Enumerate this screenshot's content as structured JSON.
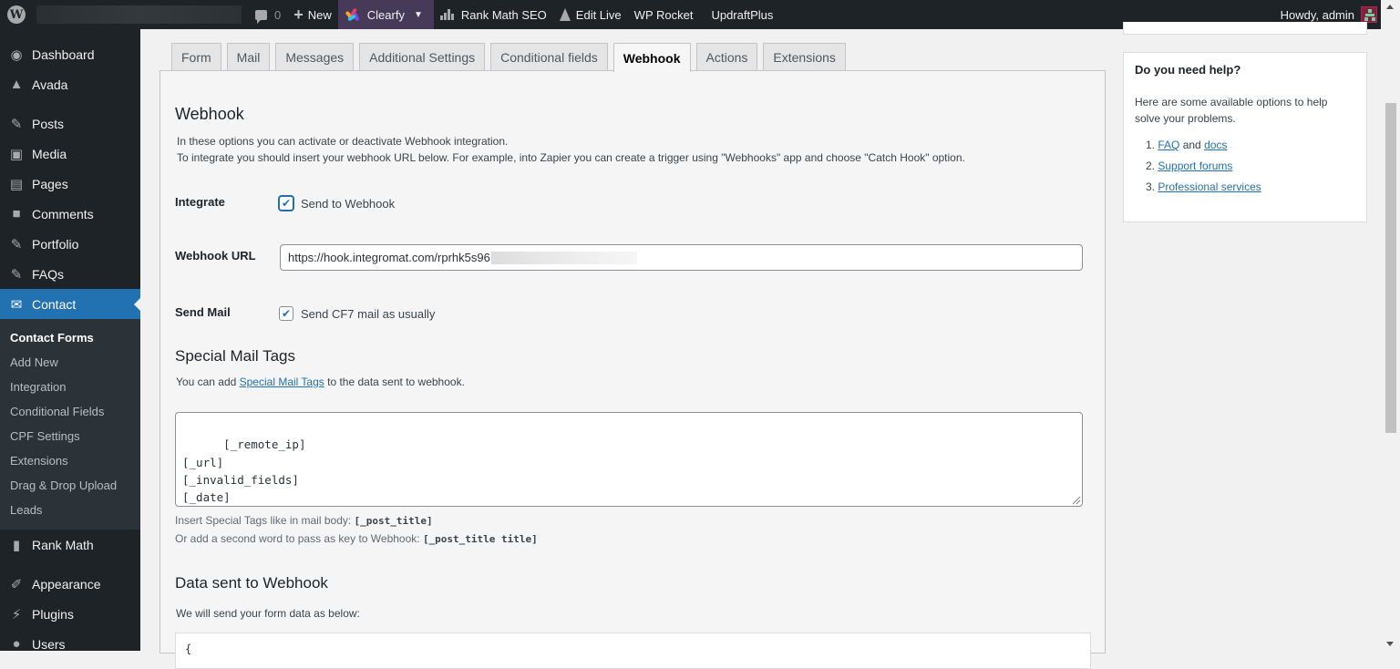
{
  "adminbar": {
    "comments_count": "0",
    "new_label": "New",
    "clearfy_label": "Clearfy",
    "rank_math_label": "Rank Math SEO",
    "edit_live_label": "Edit Live",
    "wp_rocket_label": "WP Rocket",
    "updraft_label": "UpdraftPlus",
    "howdy_label": "Howdy, admin",
    "clearfy_bg": "#473a58"
  },
  "sidebar": {
    "items": [
      {
        "label": "Dashboard",
        "icon": "dashboard-icon"
      },
      {
        "label": "Avada",
        "icon": "avada-icon"
      },
      {
        "label": "Posts",
        "icon": "pin-icon"
      },
      {
        "label": "Media",
        "icon": "media-icon"
      },
      {
        "label": "Pages",
        "icon": "pages-icon"
      },
      {
        "label": "Comments",
        "icon": "comment-icon"
      },
      {
        "label": "Portfolio",
        "icon": "pin-icon"
      },
      {
        "label": "FAQs",
        "icon": "pin-icon"
      },
      {
        "label": "Contact",
        "icon": "mail-icon"
      },
      {
        "label": "Rank Math",
        "icon": "rank-math-icon"
      },
      {
        "label": "Appearance",
        "icon": "brush-icon"
      },
      {
        "label": "Plugins",
        "icon": "plugin-icon"
      },
      {
        "label": "Users",
        "icon": "user-icon"
      }
    ],
    "submenu": [
      "Contact Forms",
      "Add New",
      "Integration",
      "Conditional Fields",
      "CPF Settings",
      "Extensions",
      "Drag & Drop Upload",
      "Leads"
    ],
    "accent": "#2271b1"
  },
  "tabs": [
    "Form",
    "Mail",
    "Messages",
    "Additional Settings",
    "Conditional fields",
    "Webhook",
    "Actions",
    "Extensions"
  ],
  "active_tab": "Webhook",
  "webhook": {
    "title": "Webhook",
    "desc_line1": "In these options you can activate or deactivate Webhook integration.",
    "desc_line2": "To integrate you should insert your webhook URL below. For example, into Zapier you can create a trigger using \"Webhooks\" app and choose \"Catch Hook\" option.",
    "integrate_label": "Integrate",
    "integrate_checkbox": "Send to Webhook",
    "integrate_checked": true,
    "url_label": "Webhook URL",
    "url_value": "https://hook.integromat.com/rprhk5s96",
    "send_mail_label": "Send Mail",
    "send_mail_checkbox": "Send CF7 mail as usually",
    "send_mail_checked": true,
    "tags_title": "Special Mail Tags",
    "tags_desc_prefix": "You can add ",
    "tags_desc_link": "Special Mail Tags",
    "tags_desc_suffix": " to the data sent to webhook.",
    "tags_value": "[_remote_ip]\n[_url]\n[_invalid_fields]\n[_date]",
    "note1_text": "Insert Special Tags like in mail body: ",
    "note1_code": "[_post_title]",
    "note2_text": "Or add a second word to pass as key to Webhook: ",
    "note2_code": "[_post_title title]",
    "data_title": "Data sent to Webhook",
    "data_desc": "We will send your form data as below:",
    "data_preview": "{"
  },
  "help": {
    "title": "Do you need help?",
    "text": "Here are some available options to help solve your problems.",
    "item1_num": "1.",
    "item1_link1": "FAQ",
    "item1_and": " and ",
    "item1_link2": "docs",
    "item2_num": "2.",
    "item2_link": "Support forums",
    "item3_num": "3.",
    "item3_link": "Professional services"
  }
}
